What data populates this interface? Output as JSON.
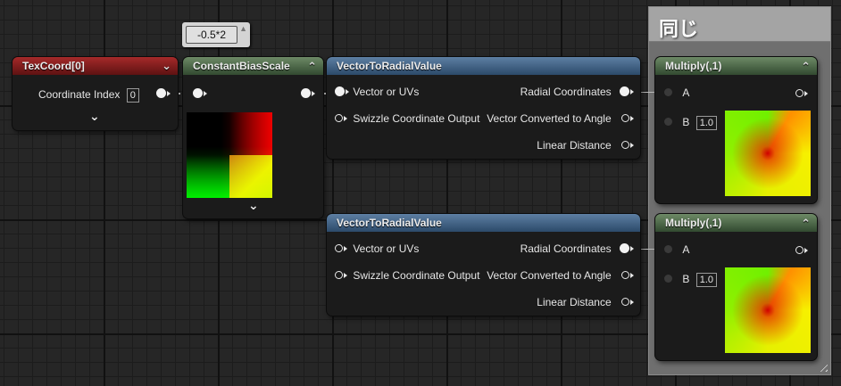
{
  "comment_box": {
    "title": "同じ"
  },
  "tooltip": {
    "text": "-0.5*2"
  },
  "texcoord": {
    "title": "TexCoord[0]",
    "input_label": "Coordinate Index",
    "input_value": "0"
  },
  "bias": {
    "title": "ConstantBiasScale"
  },
  "radial_top": {
    "title": "VectorToRadialValue",
    "in1": "Vector or UVs",
    "in2": "Swizzle Coordinate Output",
    "out1": "Radial Coordinates",
    "out2": "Vector Converted to Angle",
    "out3": "Linear Distance"
  },
  "radial_bottom": {
    "title": "VectorToRadialValue",
    "in1": "Vector or UVs",
    "in2": "Swizzle Coordinate Output",
    "out1": "Radial Coordinates",
    "out2": "Vector Converted to Angle",
    "out3": "Linear Distance"
  },
  "multiply_top": {
    "title": "Multiply(,1)",
    "pin_a": "A",
    "pin_b": "B",
    "b_value": "1.0"
  },
  "multiply_bottom": {
    "title": "Multiply(,1)",
    "pin_a": "A",
    "pin_b": "B",
    "b_value": "1.0"
  },
  "icons": [
    "chevron-down-icon",
    "chevron-up-icon",
    "pin-icon",
    "resize-grip-icon"
  ],
  "colors": {
    "texcoord_header": "#a52a2a",
    "constant_header": "#6d8a66",
    "function_header": "#5d7fa3",
    "comment_bg": "#6b6b6b"
  }
}
